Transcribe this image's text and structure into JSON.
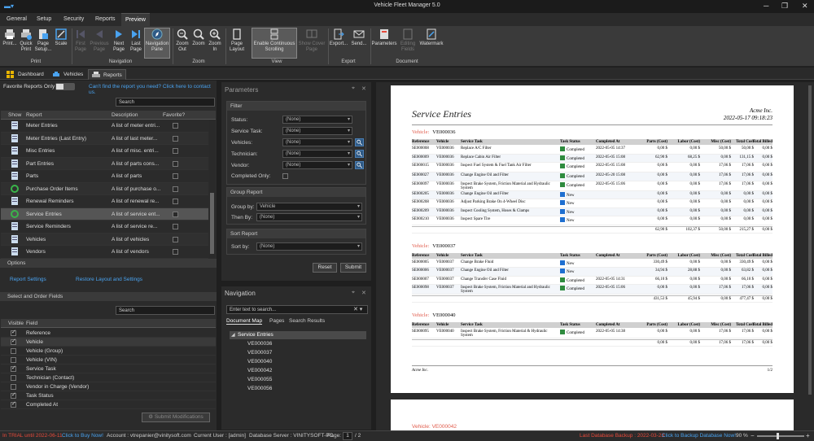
{
  "window": {
    "title": "Vehicle Fleet Manager 5.0"
  },
  "menu": [
    "General",
    "Setup",
    "Security",
    "Reports",
    "Preview"
  ],
  "ribbon": {
    "buttons": [
      {
        "label": "Print...",
        "icon": "printer-icon"
      },
      {
        "label": "Quick Print",
        "icon": "quick-print-icon"
      },
      {
        "label": "Page Setup...",
        "icon": "page-setup-icon"
      },
      {
        "label": "Scale",
        "icon": "scale-icon"
      },
      {
        "label": "First Page",
        "icon": "first-page-icon"
      },
      {
        "label": "Previous Page",
        "icon": "previous-page-icon"
      },
      {
        "label": "Next Page",
        "icon": "next-page-icon"
      },
      {
        "label": "Last Page",
        "icon": "last-page-icon"
      },
      {
        "label": "Navigation Pane",
        "icon": "compass-icon"
      },
      {
        "label": "Zoom Out",
        "icon": "zoom-out-icon"
      },
      {
        "label": "Zoom",
        "icon": "zoom-icon"
      },
      {
        "label": "Zoom In",
        "icon": "zoom-in-icon"
      },
      {
        "label": "Page Layout",
        "icon": "page-layout-icon"
      },
      {
        "label": "Enable Continuous Scrolling",
        "icon": "continuous-scroll-icon"
      },
      {
        "label": "Show Cover Page",
        "icon": "cover-page-icon"
      },
      {
        "label": "Export...",
        "icon": "export-icon"
      },
      {
        "label": "Send...",
        "icon": "send-icon"
      },
      {
        "label": "Parameters",
        "icon": "parameters-icon"
      },
      {
        "label": "Editing Fields",
        "icon": "editing-fields-icon"
      },
      {
        "label": "Watermark",
        "icon": "watermark-icon"
      }
    ],
    "groups": [
      "Print",
      "Navigation",
      "Zoom",
      "View",
      "Export",
      "Document"
    ]
  },
  "tabs": [
    "Dashboard",
    "Vehicles",
    "Reports"
  ],
  "left": {
    "favorite_label": "Favorite Reports Only",
    "help_link": "Can't find the report you need? Click here to contact us.",
    "search_placeholder": "Search",
    "columns": [
      "Show",
      "Report",
      "Description",
      "Favorite?"
    ],
    "reports": [
      {
        "name": "Meter Entries",
        "desc": "A list of meter entri..."
      },
      {
        "name": "Meter Entries (Last Entry)",
        "desc": "A list of last meter..."
      },
      {
        "name": "Misc Entries",
        "desc": "A list of misc. entri..."
      },
      {
        "name": "Part Entries",
        "desc": "A list of parts cons..."
      },
      {
        "name": "Parts",
        "desc": "A list of parts"
      },
      {
        "name": "Purchase Order Items",
        "desc": "A list of purchase o..."
      },
      {
        "name": "Renewal Reminders",
        "desc": "A list of renewal re..."
      },
      {
        "name": "Service Entries",
        "desc": "A list of service ent..."
      },
      {
        "name": "Service Reminders",
        "desc": "A list of service re..."
      },
      {
        "name": "Vehicles",
        "desc": "A list of vehicles"
      },
      {
        "name": "Vendors",
        "desc": "A list of vendors"
      }
    ],
    "options_title": "Options",
    "report_settings": "Report Settings",
    "restore_layout": "Restore Layout and Settings",
    "fields_title": "Select and Order Fields",
    "fields_search": "Search",
    "fields_columns": [
      "Visible",
      "Field"
    ],
    "fields": [
      {
        "name": "Reference",
        "on": true
      },
      {
        "name": "Vehicle",
        "on": true
      },
      {
        "name": "Vehicle (Group)",
        "on": false
      },
      {
        "name": "Vehicle (VIN)",
        "on": false
      },
      {
        "name": "Service Task",
        "on": true
      },
      {
        "name": "Technician (Contact)",
        "on": false
      },
      {
        "name": "Vendor in Charge (Vendor)",
        "on": false
      },
      {
        "name": "Task Status",
        "on": true
      },
      {
        "name": "Completed At",
        "on": true
      }
    ],
    "submit_mods": "Submit Modifications"
  },
  "params": {
    "title": "Parameters",
    "filter_title": "Filter",
    "filters": [
      {
        "label": "Status:",
        "value": "(None)"
      },
      {
        "label": "Service Task:",
        "value": "(None)"
      },
      {
        "label": "Vehicles:",
        "value": "(None)"
      },
      {
        "label": "Technician:",
        "value": "(None)"
      },
      {
        "label": "Vendor:",
        "value": "(None)"
      }
    ],
    "completed_only": "Completed Only:",
    "group_title": "Group Report",
    "group_by_label": "Group by:",
    "group_by": "Vehicle",
    "then_by_label": "Then By:",
    "then_by": "(None)",
    "sort_title": "Sort Report",
    "sort_by_label": "Sort by:",
    "sort_by": "(None)",
    "reset": "Reset",
    "submit": "Submit"
  },
  "navigation": {
    "title": "Navigation",
    "search_placeholder": "Enter text to search...",
    "tabs": [
      "Document Map",
      "Pages",
      "Search Results"
    ],
    "root": "Service Entries",
    "items": [
      "VE000036",
      "VE000037",
      "VE000040",
      "VE000042",
      "VE000055",
      "VE000056"
    ]
  },
  "report": {
    "title": "Service Entries",
    "company": "Acme Inc.",
    "date": "2022-05-17 09:18:23",
    "columns": [
      "Reference",
      "Vehicle",
      "Service Task",
      "Task Status",
      "Completed At",
      "Parts (Cost)",
      "Labor (Cost)",
      "Misc (Cost)",
      "Total Cost",
      "Total Billed"
    ],
    "vehicle_label": "Vehicle:",
    "groups": [
      {
        "vehicle": "VE000036",
        "rows": [
          [
            "SE000008",
            "VE000036",
            "Replace A/C Filter",
            "Completed",
            "2022-05-05 14:37",
            "0,00 $",
            "0,00 $",
            "50,00 $",
            "50,00 $",
            "0,00 $"
          ],
          [
            "SE000009",
            "VE000036",
            "Replace Cabin Air Filter",
            "Completed",
            "2022-05-05 15:08",
            "62,90 $",
            "68,25 $",
            "0,00 $",
            "131,15 $",
            "0,00 $"
          ],
          [
            "SE000015",
            "VE000036",
            "Inspect Fuel System & Fuel Tank Air Filter",
            "Completed",
            "2022-05-05 15:08",
            "0,00 $",
            "0,00 $",
            "17,06 $",
            "17,06 $",
            "0,00 $"
          ],
          [
            "SE000027",
            "VE000036",
            "Change Engine Oil and Filter",
            "Completed",
            "2022-05-20 15:08",
            "0,00 $",
            "0,00 $",
            "17,06 $",
            "17,06 $",
            "0,00 $"
          ],
          [
            "SE000097",
            "VE000036",
            "Inspect Brake System, Friction Material and Hydraulic System",
            "Completed",
            "2022-05-05 15:06",
            "0,00 $",
            "0,00 $",
            "17,06 $",
            "17,06 $",
            "0,00 $"
          ],
          [
            "SE000205",
            "VE000036",
            "Change Engine Oil and Filter",
            "New",
            "",
            "0,00 $",
            "0,00 $",
            "0,00 $",
            "0,00 $",
            "0,00 $"
          ],
          [
            "SE000208",
            "VE000036",
            "Adjust Parking Brake On 4-Wheel Disc",
            "New",
            "",
            "0,00 $",
            "0,00 $",
            "0,00 $",
            "0,00 $",
            "0,00 $"
          ],
          [
            "SE000209",
            "VE000036",
            "Inspect Cooling System, Hoses & Clamps",
            "New",
            "",
            "0,00 $",
            "0,00 $",
            "0,00 $",
            "0,00 $",
            "0,00 $"
          ],
          [
            "SE000210",
            "VE000036",
            "Inspect Spare Tire",
            "New",
            "",
            "0,00 $",
            "0,00 $",
            "0,00 $",
            "0,00 $",
            "0,00 $"
          ]
        ],
        "total": [
          "62,90 $",
          "102,37 $",
          "50,00 $",
          "215,27 $",
          "0,00 $"
        ]
      },
      {
        "vehicle": "VE000037",
        "rows": [
          [
            "SE000005",
            "VE000037",
            "Change Brake Fluid",
            "New",
            "",
            "330,49 $",
            "0,00 $",
            "0,00 $",
            "330,49 $",
            "0,00 $"
          ],
          [
            "SE000006",
            "VE000037",
            "Change Engine Oil and Filter",
            "New",
            "",
            "34,94 $",
            "28,88 $",
            "0,00 $",
            "63,82 $",
            "0,00 $"
          ],
          [
            "SE000007",
            "VE000037",
            "Change Transfer Case Fluid",
            "Completed",
            "2022-05-05 14:31",
            "66,10 $",
            "0,00 $",
            "0,00 $",
            "66,10 $",
            "0,00 $"
          ],
          [
            "SE000098",
            "VE000037",
            "Inspect Brake System, Friction Material and Hydraulic System",
            "Completed",
            "2022-05-05 15:06",
            "0,00 $",
            "0,00 $",
            "17,06 $",
            "17,06 $",
            "0,00 $"
          ]
        ],
        "total": [
          "431,53 $",
          "45,94 $",
          "0,00 $",
          "477,47 $",
          "0,00 $"
        ]
      },
      {
        "vehicle": "VE000040",
        "rows": [
          [
            "SE000095",
            "VE000040",
            "Inspect Brake System, Friction Material & Hydraulic System",
            "Completed",
            "2022-05-05 14:38",
            "0,00 $",
            "0,00 $",
            "17,06 $",
            "17,06 $",
            "0,00 $"
          ]
        ],
        "total": [
          "0,00 $",
          "0,00 $",
          "17,06 $",
          "17,06 $",
          "0,00 $"
        ]
      }
    ],
    "footer_left": "Acme Inc.",
    "footer_right": "1/2",
    "next_page_vehicle": "Vehicle: VE000042"
  },
  "status": {
    "trial": "In TRIAL until 2022-06-11",
    "buy": "Click to Buy Now!",
    "account": "Account : vtrepanier@vinitysoft.com",
    "user": "Current User : [admin]",
    "server": "Database Server : VINITYSOFT-PC",
    "page_label": "Page:",
    "page": "1",
    "pages": "/ 2",
    "backup": "Last Database Backup : 2022-03-23",
    "backup_link": "Click to Backup Database Now!",
    "zoom": "90 %"
  },
  "colors": {
    "completed": "#2e8b3e",
    "new": "#1e6fd0",
    "accent_red": "#e74a3b",
    "link": "#4aa3f0"
  }
}
